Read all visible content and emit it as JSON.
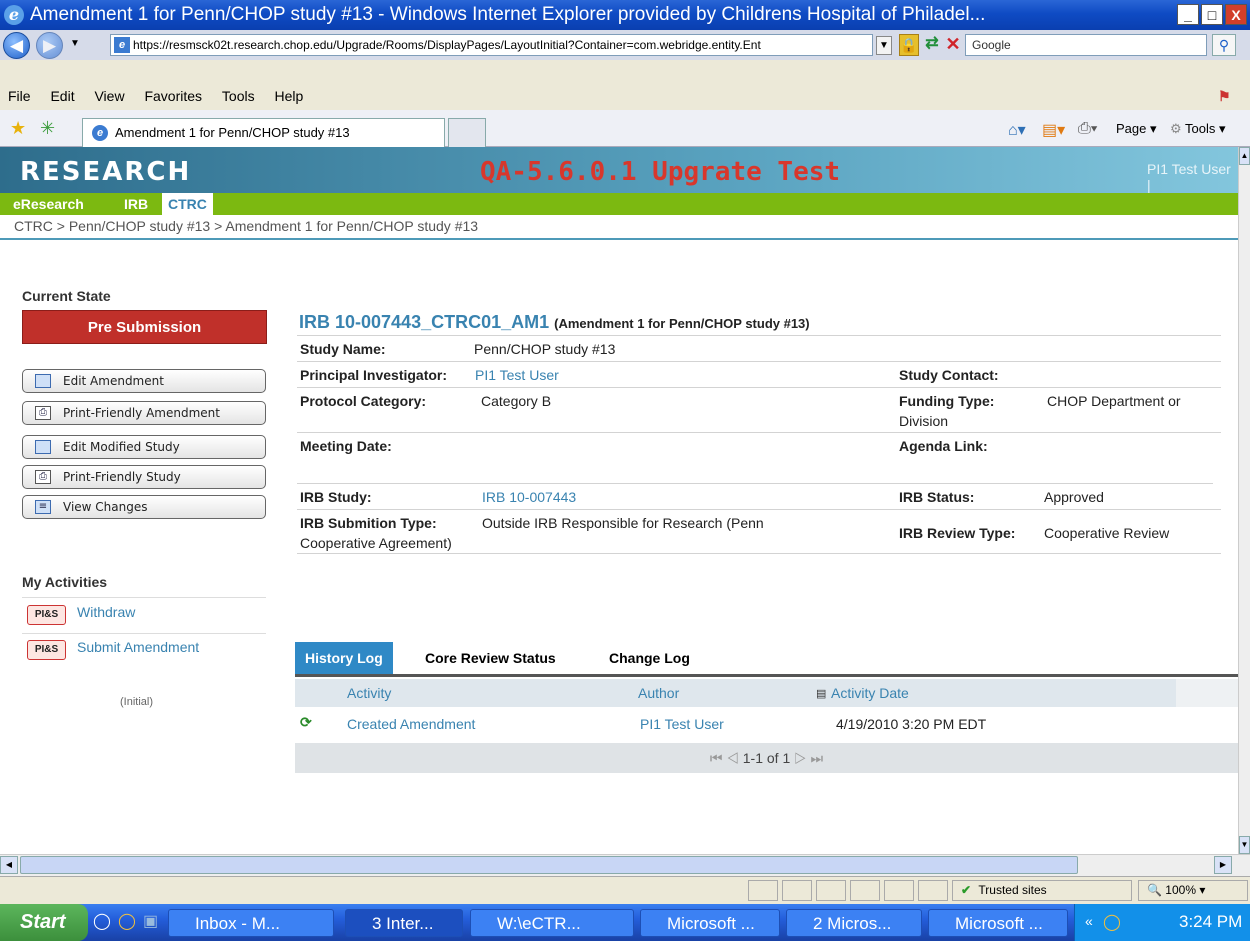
{
  "window": {
    "title": "Amendment 1 for Penn/CHOP study #13 - Windows Internet Explorer provided by Childrens Hospital of Philadel...",
    "minimize": "_",
    "maximize": "□",
    "close": "X"
  },
  "address_bar": {
    "url": "https://resmsck02t.research.chop.edu/Upgrade/Rooms/DisplayPages/LayoutInitial?Container=com.webridge.entity.Ent",
    "search_placeholder": "Google"
  },
  "menu": [
    "File",
    "Edit",
    "View",
    "Favorites",
    "Tools",
    "Help"
  ],
  "browser_tab": {
    "title": "Amendment 1 for Penn/CHOP study #13",
    "page_menu": "Page",
    "tools_menu": "Tools"
  },
  "banner": {
    "logo": "RESEARCH",
    "environment": "QA-5.6.0.1 Upgrate Test",
    "user": "PI1 Test User |"
  },
  "nav_tabs": [
    "eResearch",
    "IRB",
    "CTRC"
  ],
  "breadcrumb": "CTRC  >  Penn/CHOP study #13  >  Amendment 1 for Penn/CHOP study #13",
  "sidebar": {
    "current_state_label": "Current State",
    "state": "Pre Submission",
    "buttons": [
      "Edit Amendment",
      "Print-Friendly Amendment",
      "Edit Modified Study",
      "Print-Friendly Study",
      "View Changes"
    ],
    "activities_label": "My Activities",
    "activities": [
      {
        "badge": "PI&S",
        "label": "Withdraw"
      },
      {
        "badge": "PI&S",
        "label": "Submit Amendment"
      }
    ],
    "initial_note": "(Initial)"
  },
  "record": {
    "id": "IRB 10-007443_CTRC01_AM1",
    "subtitle": "(Amendment 1 for Penn/CHOP study #13)",
    "study_name_label": "Study Name:",
    "study_name": "Penn/CHOP study #13",
    "pi_label": "Principal Investigator:",
    "pi": "PI1 Test User",
    "study_contact_label": "Study Contact:",
    "protocol_category_label": "Protocol Category:",
    "protocol_category": "Category B",
    "funding_type_label": "Funding Type:",
    "funding_type_line1": "CHOP Department or",
    "funding_type_line2": "Division",
    "meeting_date_label": "Meeting Date:",
    "agenda_link_label": "Agenda Link:",
    "irb_study_label": "IRB Study:",
    "irb_study": "IRB 10-007443",
    "irb_status_label": "IRB Status:",
    "irb_status": "Approved",
    "submission_type_label": "IRB Submition Type:",
    "submission_type_line1": "Outside IRB Responsible for Research (Penn",
    "submission_type_line2": "Cooperative Agreement)",
    "review_type_label": "IRB Review Type:",
    "review_type": "Cooperative Review"
  },
  "history": {
    "tabs": [
      "History Log",
      "Core Review Status",
      "Change Log"
    ],
    "columns": [
      "Activity",
      "Author",
      "Activity Date"
    ],
    "rows": [
      {
        "activity": "Created Amendment",
        "author": "PI1 Test User",
        "date": "4/19/2010 3:20 PM EDT"
      }
    ],
    "pager": "1-1 of 1"
  },
  "status_bar": {
    "zone": "Trusted sites",
    "zoom": "100%"
  },
  "taskbar": {
    "start": "Start",
    "items": [
      "Inbox - M...",
      "3 Inter...",
      "W:\\eCTR...",
      "Microsoft ...",
      "2 Micros...",
      "Microsoft ..."
    ],
    "time": "3:24 PM"
  }
}
